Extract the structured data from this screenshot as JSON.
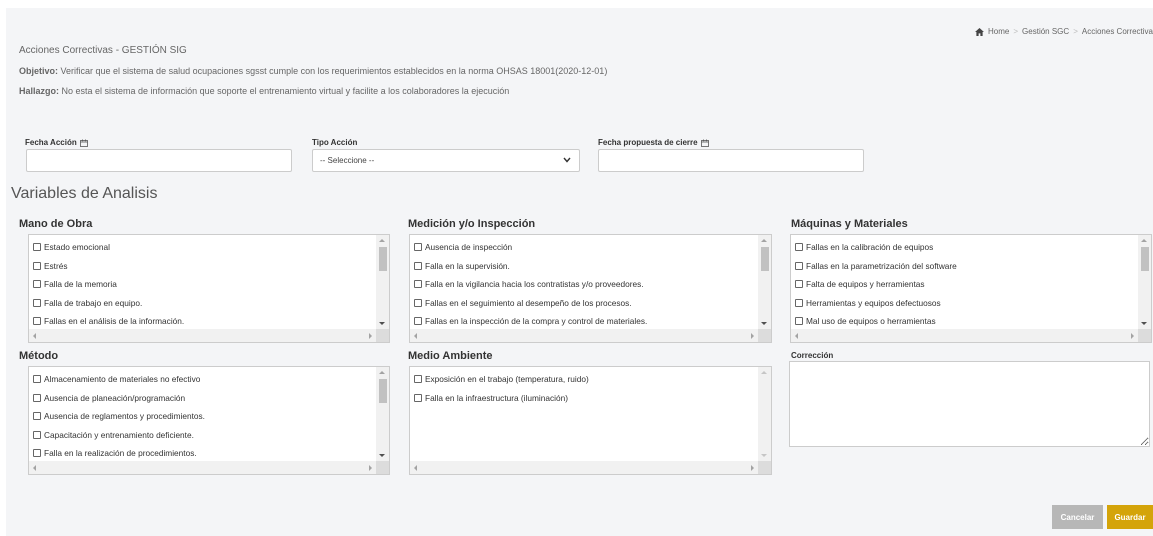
{
  "breadcrumb": {
    "home_icon": "home-icon",
    "items": [
      "Home",
      "Gestión SGC",
      "Acciones Correctiva"
    ],
    "separator": ">"
  },
  "header": {
    "title": "Acciones Correctivas - GESTIÓN SIG",
    "objetivo_label": "Objetivo:",
    "objetivo_text": " Verificar que el sistema de salud ocupaciones sgsst cumple con los requerimientos establecidos en la norma OHSAS 18001(2020-12-01)",
    "hallazgo_label": "Hallazgo:",
    "hallazgo_text": " No esta el sistema de información que soporte el entrenamiento virtual y facilite a los colaboradores la ejecución"
  },
  "form": {
    "fecha_accion": {
      "label": "Fecha Acción",
      "icon": "calendar-icon",
      "value": ""
    },
    "tipo_accion": {
      "label": "Tipo Acción",
      "selected": "-- Seleccione --"
    },
    "fecha_cierre": {
      "label": "Fecha propuesta de cierre",
      "icon": "calendar-icon",
      "value": ""
    }
  },
  "variables": {
    "section_title": "Variables de Analisis",
    "groups": [
      {
        "title": "Mano de Obra",
        "items": [
          "Estado emocional",
          "Estrés",
          "Falla de la memoria",
          "Falla de trabajo en equipo.",
          "Fallas en el análisis de la información."
        ]
      },
      {
        "title": "Medición y/o Inspección",
        "items": [
          "Ausencia de inspección",
          "Falla en la supervisión.",
          "Falla en la vigilancia hacia los contratistas y/o proveedores.",
          "Fallas en el seguimiento al desempeño de los procesos.",
          "Fallas en la inspección de la compra y control de materiales."
        ]
      },
      {
        "title": "Máquinas y Materiales",
        "items": [
          "Fallas en la calibración de equipos",
          "Fallas en la parametrización del software",
          "Falta de equipos y herramientas",
          "Herramientas y equipos defectuosos",
          "Mal uso de equipos o herramientas"
        ]
      },
      {
        "title": "Método",
        "items": [
          "Almacenamiento de materiales no efectivo",
          "Ausencia de planeación/programación",
          "Ausencia de reglamentos y procedimientos.",
          "Capacitación y entrenamiento deficiente.",
          "Falla en la realización de procedimientos."
        ]
      },
      {
        "title": "Medio Ambiente",
        "items": [
          "Exposición en el trabajo (temperatura, ruido)",
          "Falla en la infraestructura (iluminación)"
        ]
      }
    ],
    "correccion_label": "Corrección"
  },
  "actions": {
    "cancel": "Cancelar",
    "save": "Guardar"
  },
  "colors": {
    "save_button": "#d4a40a",
    "cancel_button": "#b7b7b7",
    "background": "#f4f5f7"
  }
}
